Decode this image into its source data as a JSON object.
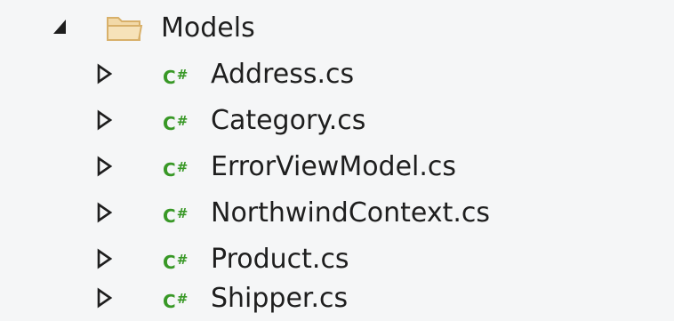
{
  "tree": {
    "folder": {
      "label": "Models",
      "expand_icon": "expanded-triangle-icon",
      "icon": "folder-icon"
    },
    "items": [
      {
        "label": "Address.cs",
        "file_icon": "csharp-file-icon",
        "file_icon_text": "C",
        "file_icon_suffix": "#"
      },
      {
        "label": "Category.cs",
        "file_icon": "csharp-file-icon",
        "file_icon_text": "C",
        "file_icon_suffix": "#"
      },
      {
        "label": "ErrorViewModel.cs",
        "file_icon": "csharp-file-icon",
        "file_icon_text": "C",
        "file_icon_suffix": "#"
      },
      {
        "label": "NorthwindContext.cs",
        "file_icon": "csharp-file-icon",
        "file_icon_text": "C",
        "file_icon_suffix": "#"
      },
      {
        "label": "Product.cs",
        "file_icon": "csharp-file-icon",
        "file_icon_text": "C",
        "file_icon_suffix": "#"
      },
      {
        "label": "Shipper.cs",
        "file_icon": "csharp-file-icon",
        "file_icon_text": "C",
        "file_icon_suffix": "#"
      }
    ]
  },
  "colors": {
    "background": "#f5f6f7",
    "text": "#1e1e1e",
    "csharp_icon": "#389826",
    "folder_fill": "#f2d9a8",
    "folder_stroke": "#d8b06a",
    "toggle": "#1e1e1e"
  }
}
